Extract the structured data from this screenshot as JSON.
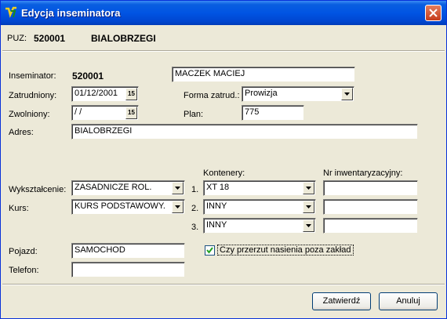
{
  "window": {
    "title": "Edycja inseminatora"
  },
  "puz": {
    "label": "PUZ:",
    "code": "520001",
    "name": "BIALOBRZEGI"
  },
  "form": {
    "inseminator_label": "Inseminator:",
    "inseminator_code": "520001",
    "inseminator_name": "MACZEK MACIEJ",
    "zatrudniony_label": "Zatrudniony:",
    "zatrudniony_value": "01/12/2001",
    "zwolniony_label": "Zwolniony:",
    "zwolniony_value": " / /",
    "calendar_icon_text": "15",
    "forma_label": "Forma zatrud.:",
    "forma_value": "Prowizja",
    "plan_label": "Plan:",
    "plan_value": "775",
    "adres_label": "Adres:",
    "adres_value": "BIALOBRZEGI",
    "wyksztalcenie_label": "Wykształcenie:",
    "wyksztalcenie_value": "ZASADNICZE ROL.",
    "kurs_label": "Kurs:",
    "kurs_value": "KURS PODSTAWOWY.",
    "kontenery_header": "Kontenery:",
    "nr_inw_header": "Nr inwentaryzacyjny:",
    "kontenery": [
      {
        "num": "1.",
        "value": "XT 18",
        "inv": ""
      },
      {
        "num": "2.",
        "value": "INNY",
        "inv": ""
      },
      {
        "num": "3.",
        "value": "INNY",
        "inv": ""
      }
    ],
    "pojazd_label": "Pojazd:",
    "pojazd_value": "SAMOCHOD",
    "telefon_label": "Telefon:",
    "telefon_value": "",
    "przerzut_label": "Czy przerzut nasienia poza zakład",
    "przerzut_checked": true
  },
  "buttons": {
    "zatwierdz": "Zatwierdź",
    "anuluj": "Anuluj"
  },
  "colors": {
    "titlebar": "#0054e3",
    "face": "#ece9d8",
    "close": "#c63c1b"
  }
}
